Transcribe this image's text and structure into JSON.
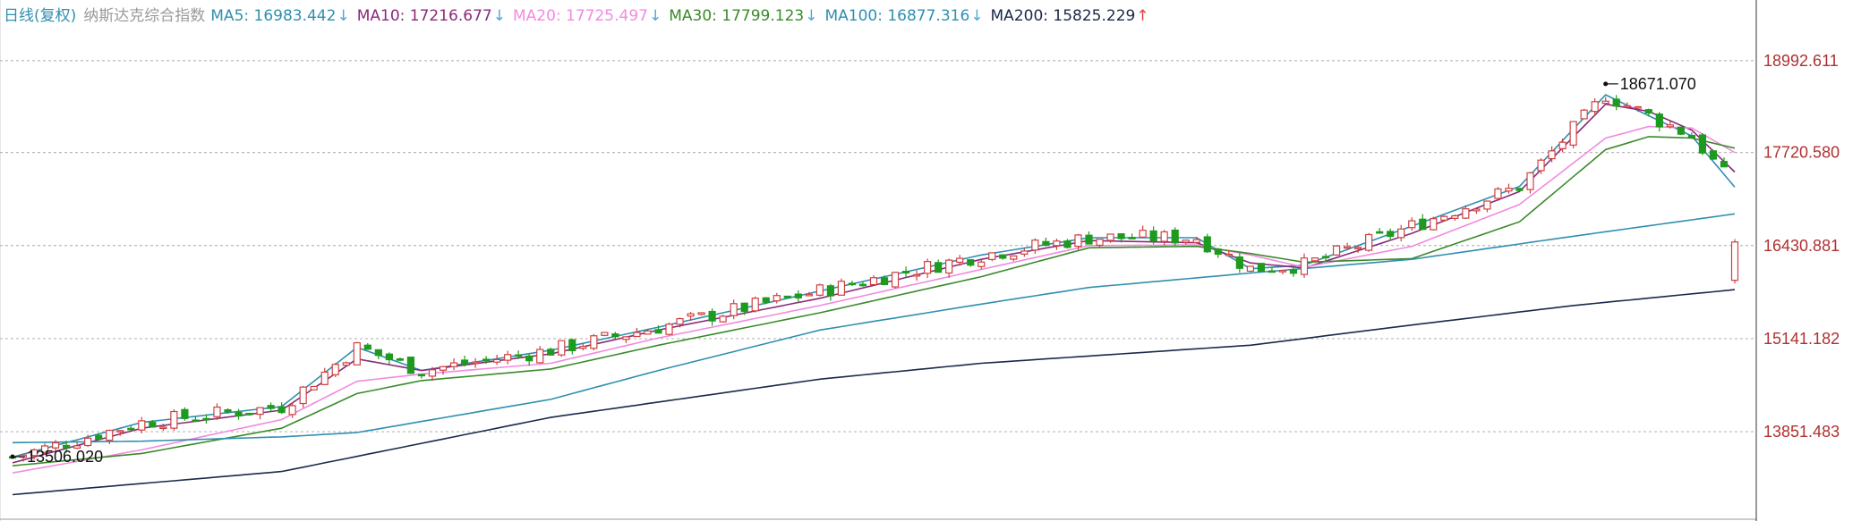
{
  "legend": {
    "period": "日线(复权)",
    "name": "纳斯达克综合指数",
    "items": [
      {
        "label": "MA5: 16983.442",
        "arrow": "↓",
        "color": "#2f8fb0",
        "arrow_color": "#4aa8d8"
      },
      {
        "label": "MA10: 17216.677",
        "arrow": "↓",
        "color": "#8a2a7a",
        "arrow_color": "#4aa8d8"
      },
      {
        "label": "MA20: 17725.497",
        "arrow": "↓",
        "color": "#f28ae0",
        "arrow_color": "#4aa8d8"
      },
      {
        "label": "MA30: 17799.123",
        "arrow": "↓",
        "color": "#3a8a2a",
        "arrow_color": "#4aa8d8"
      },
      {
        "label": "MA100: 16877.316",
        "arrow": "↓",
        "color": "#2f8fb0",
        "arrow_color": "#4aa8d8"
      },
      {
        "label": "MA200: 15825.229",
        "arrow": "↑",
        "color": "#1a2a4a",
        "arrow_color": "#e04040"
      }
    ]
  },
  "colors": {
    "up": "#d04040",
    "down": "#1e9a1e",
    "grid": "#b8b8b8",
    "axis_text": "#b03030"
  },
  "chart_data": {
    "type": "candlestick",
    "ylim": [
      12800,
      19400
    ],
    "y_ticks": [
      13851.483,
      15141.182,
      16430.881,
      17720.58,
      18992.611
    ],
    "y_tick_labels": [
      "13851.483",
      "15141.182",
      "16430.881",
      "17720.580",
      "18992.611"
    ],
    "grid": true,
    "annotations": [
      {
        "label": "18671.070",
        "value": 18671.07,
        "bar_index": 148
      },
      {
        "label": "13506.020",
        "value": 13506.02,
        "bar_index": 0
      }
    ],
    "ma_lines": [
      {
        "name": "MA5",
        "color": "#2f8fb0",
        "points": [
          [
            0,
            13500
          ],
          [
            12,
            13980
          ],
          [
            25,
            14200
          ],
          [
            32,
            15020
          ],
          [
            38,
            14700
          ],
          [
            50,
            14980
          ],
          [
            60,
            15300
          ],
          [
            75,
            15800
          ],
          [
            90,
            16300
          ],
          [
            100,
            16540
          ],
          [
            110,
            16540
          ],
          [
            115,
            16110
          ],
          [
            120,
            16160
          ],
          [
            130,
            16700
          ],
          [
            140,
            17250
          ],
          [
            148,
            18520
          ],
          [
            152,
            18230
          ],
          [
            156,
            17950
          ],
          [
            160,
            17240
          ]
        ]
      },
      {
        "name": "MA10",
        "color": "#8a2a7a",
        "points": [
          [
            0,
            13420
          ],
          [
            12,
            13900
          ],
          [
            25,
            14150
          ],
          [
            32,
            14860
          ],
          [
            38,
            14700
          ],
          [
            50,
            14930
          ],
          [
            60,
            15260
          ],
          [
            75,
            15700
          ],
          [
            90,
            16240
          ],
          [
            100,
            16500
          ],
          [
            110,
            16470
          ],
          [
            115,
            16190
          ],
          [
            120,
            16120
          ],
          [
            130,
            16600
          ],
          [
            140,
            17180
          ],
          [
            148,
            18390
          ],
          [
            152,
            18290
          ],
          [
            156,
            18030
          ],
          [
            160,
            17450
          ]
        ]
      },
      {
        "name": "MA20",
        "color": "#f28ae0",
        "points": [
          [
            0,
            13280
          ],
          [
            12,
            13600
          ],
          [
            25,
            14020
          ],
          [
            32,
            14550
          ],
          [
            38,
            14650
          ],
          [
            50,
            14800
          ],
          [
            60,
            15150
          ],
          [
            75,
            15600
          ],
          [
            90,
            16100
          ],
          [
            100,
            16430
          ],
          [
            110,
            16440
          ],
          [
            115,
            16300
          ],
          [
            120,
            16130
          ],
          [
            130,
            16420
          ],
          [
            140,
            17000
          ],
          [
            148,
            17920
          ],
          [
            152,
            18080
          ],
          [
            156,
            18060
          ],
          [
            160,
            17720
          ]
        ]
      },
      {
        "name": "MA30",
        "color": "#3a8a2a",
        "points": [
          [
            0,
            13380
          ],
          [
            12,
            13550
          ],
          [
            25,
            13900
          ],
          [
            32,
            14380
          ],
          [
            38,
            14560
          ],
          [
            50,
            14720
          ],
          [
            60,
            15050
          ],
          [
            75,
            15500
          ],
          [
            90,
            16000
          ],
          [
            100,
            16400
          ],
          [
            110,
            16420
          ],
          [
            115,
            16320
          ],
          [
            120,
            16200
          ],
          [
            130,
            16250
          ],
          [
            140,
            16760
          ],
          [
            148,
            17760
          ],
          [
            152,
            17940
          ],
          [
            156,
            17920
          ],
          [
            160,
            17780
          ]
        ]
      },
      {
        "name": "MA100",
        "color": "#2f8fb0",
        "points": [
          [
            0,
            13700
          ],
          [
            12,
            13720
          ],
          [
            25,
            13780
          ],
          [
            32,
            13840
          ],
          [
            50,
            14300
          ],
          [
            60,
            14700
          ],
          [
            75,
            15260
          ],
          [
            90,
            15620
          ],
          [
            100,
            15850
          ],
          [
            115,
            16050
          ],
          [
            130,
            16240
          ],
          [
            145,
            16560
          ],
          [
            160,
            16870
          ]
        ]
      },
      {
        "name": "MA200",
        "color": "#1a2a4a",
        "points": [
          [
            0,
            12980
          ],
          [
            25,
            13300
          ],
          [
            50,
            14050
          ],
          [
            75,
            14580
          ],
          [
            90,
            14800
          ],
          [
            100,
            14900
          ],
          [
            115,
            15050
          ],
          [
            130,
            15330
          ],
          [
            145,
            15600
          ],
          [
            160,
            15820
          ]
        ]
      }
    ]
  }
}
